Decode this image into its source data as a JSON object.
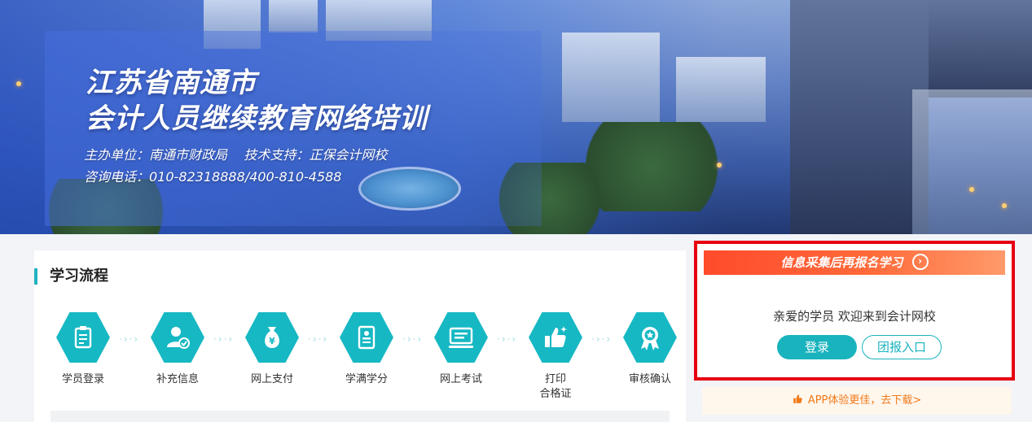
{
  "banner": {
    "title_line1": "江苏省南通市",
    "title_line2": "会计人员继续教育网络培训",
    "organizer": "主办单位：南通市财政局    技术支持：正保会计网校",
    "hotline": "咨询电话：010-82318888/400-810-4588"
  },
  "process": {
    "heading": "学习流程",
    "steps": [
      {
        "label": "学员登录",
        "icon": "clipboard-icon"
      },
      {
        "label": "补充信息",
        "icon": "user-check-icon"
      },
      {
        "label": "网上支付",
        "icon": "money-bag-icon"
      },
      {
        "label": "学满学分",
        "icon": "document-person-icon"
      },
      {
        "label": "网上考试",
        "icon": "monitor-icon"
      },
      {
        "label": "打印\n合格证",
        "line1": "打印",
        "line2": "合格证",
        "icon": "thumbs-up-icon"
      },
      {
        "label": "审核确认",
        "icon": "award-icon"
      }
    ]
  },
  "login_panel": {
    "banner_text": "信息采集后再报名学习",
    "banner_arrow": "›",
    "welcome": "亲爱的学员 欢迎来到会计网校",
    "login_button": "登录",
    "group_button": "团报入口"
  },
  "app_bar": {
    "text": "APP体验更佳，去下载>"
  },
  "colors": {
    "accent": "#16b8c3",
    "highlight_border": "#e60012",
    "banner_orange": "#ff5a30",
    "app_text": "#f07a1a"
  }
}
